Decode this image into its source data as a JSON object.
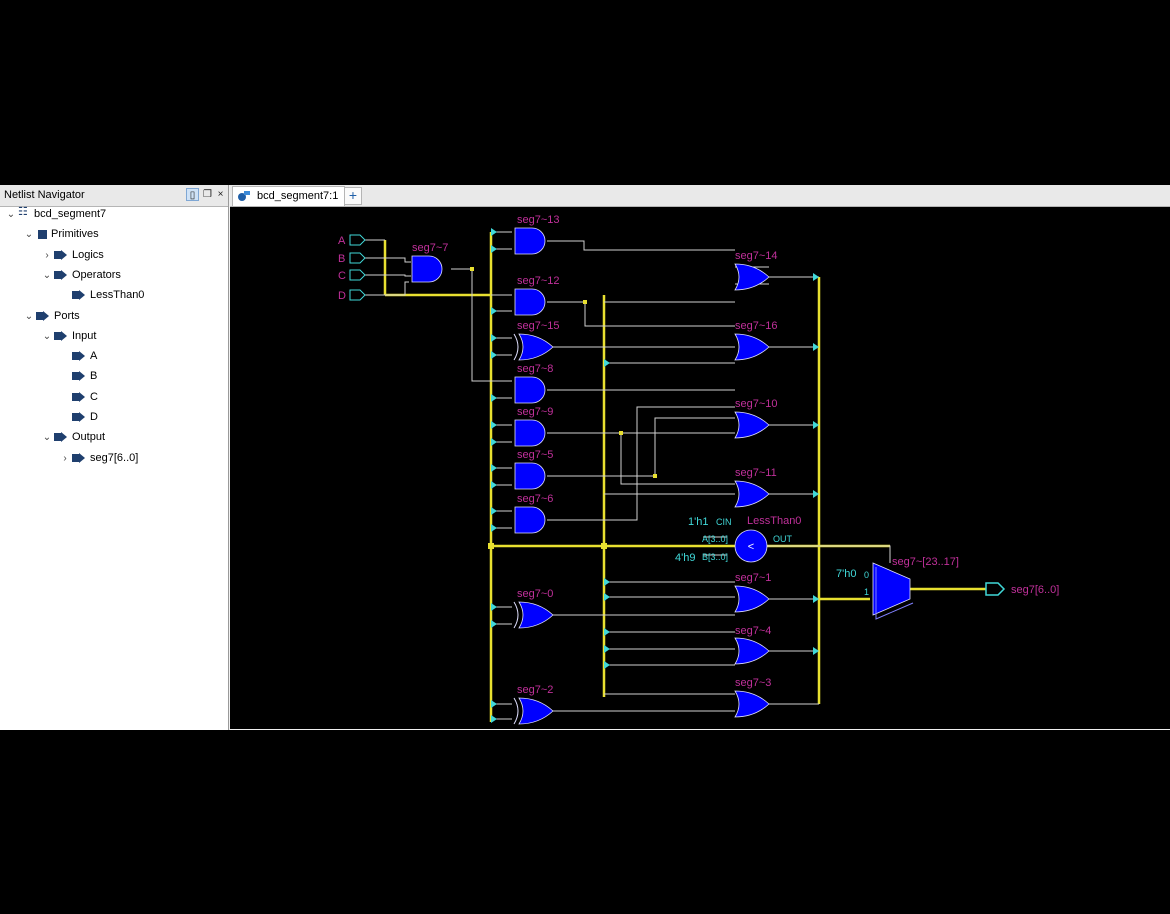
{
  "navigator": {
    "title": "Netlist Navigator",
    "tree": [
      {
        "label": "bcd_segment7",
        "expanded": true,
        "icon": "design-tree-icon"
      },
      {
        "label": "Primitives",
        "expanded": true,
        "icon": "primitive-icon"
      },
      {
        "label": "Logics",
        "expanded": false,
        "icon": "logic-icon"
      },
      {
        "label": "Operators",
        "expanded": true,
        "icon": "operator-icon"
      },
      {
        "label": "LessThan0",
        "icon": "operator-icon"
      },
      {
        "label": "Ports",
        "expanded": true,
        "icon": "port-icon"
      },
      {
        "label": "Input",
        "expanded": true,
        "icon": "port-icon"
      },
      {
        "label": "A",
        "icon": "port-icon"
      },
      {
        "label": "B",
        "icon": "port-icon"
      },
      {
        "label": "C",
        "icon": "port-icon"
      },
      {
        "label": "D",
        "icon": "port-icon"
      },
      {
        "label": "Output",
        "expanded": true,
        "icon": "port-icon"
      },
      {
        "label": "seg7[6..0]",
        "expanded": false,
        "icon": "port-icon"
      }
    ]
  },
  "editor": {
    "tab_label": "bcd_segment7:1",
    "add_tab": "+"
  },
  "schematic": {
    "inputs": [
      "A",
      "B",
      "C",
      "D"
    ],
    "gates": {
      "g7": "seg7~7",
      "g13": "seg7~13",
      "g12": "seg7~12",
      "g15": "seg7~15",
      "g8": "seg7~8",
      "g9": "seg7~9",
      "g5": "seg7~5",
      "g6": "seg7~6",
      "g0": "seg7~0",
      "g2": "seg7~2",
      "g14": "seg7~14",
      "g16": "seg7~16",
      "g10": "seg7~10",
      "g11": "seg7~11",
      "g1": "seg7~1",
      "g4": "seg7~4",
      "g3": "seg7~3"
    },
    "comparator": {
      "name": "LessThan0",
      "cin_const": "1'h1",
      "cin": "CIN",
      "a_port": "A[3..0]",
      "b_const": "4'h9",
      "b_port": "B[3..0]",
      "out": "OUT",
      "symbol": "<"
    },
    "mux": {
      "name": "seg7~[23..17]",
      "const0": "7'h0",
      "sel0": "0",
      "sel1": "1"
    },
    "output": "seg7[6..0]"
  },
  "colors": {
    "gate_fill": "#0000ff",
    "wire": "#d8d8d8",
    "bus": "#e8e030",
    "pin": "#40d8d8",
    "label": "#c0309a"
  }
}
